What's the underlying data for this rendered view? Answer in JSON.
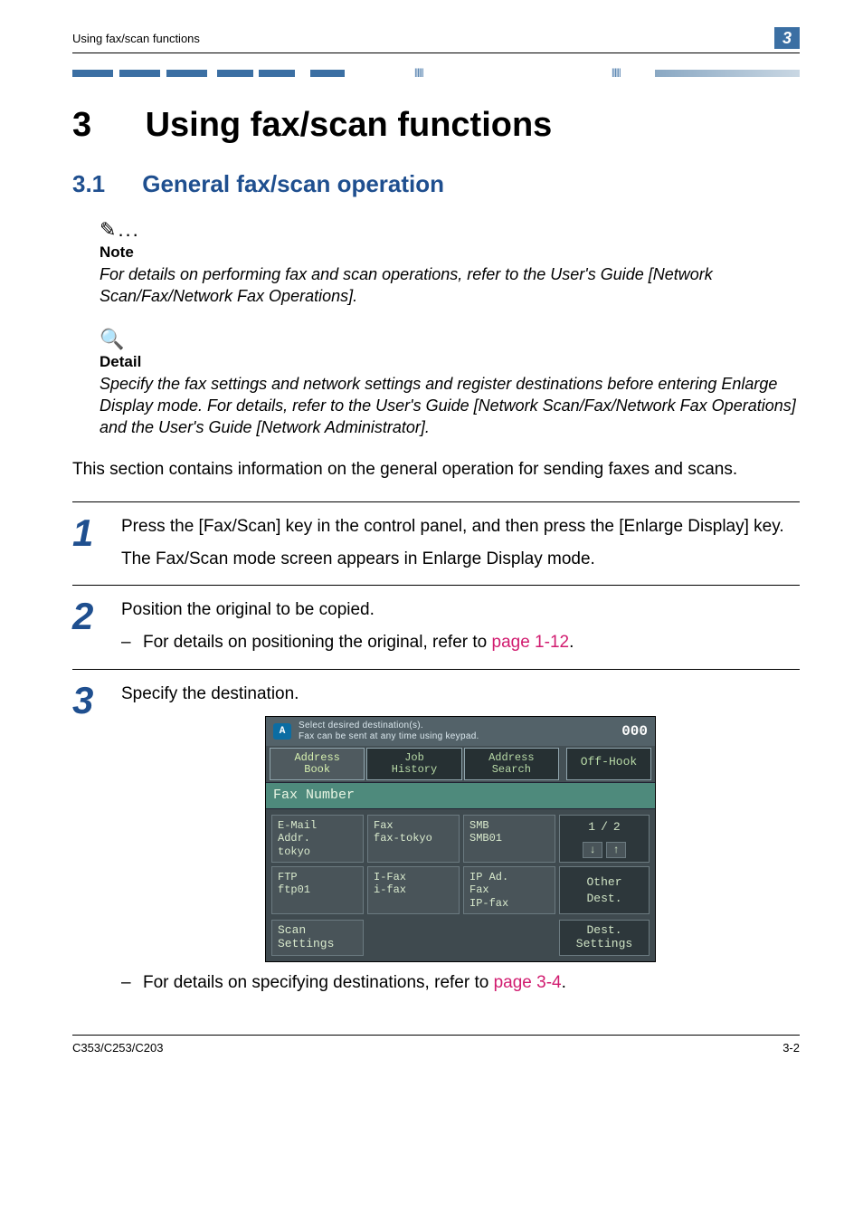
{
  "header": {
    "breadcrumb": "Using fax/scan functions",
    "cornerNum": "3"
  },
  "chapter": {
    "num": "3",
    "title": "Using fax/scan functions"
  },
  "section": {
    "num": "3.1",
    "title": "General fax/scan operation"
  },
  "note": {
    "label": "Note",
    "body": "For details on performing fax and scan operations, refer to the User's Guide [Network Scan/Fax/Network Fax Operations]."
  },
  "detail": {
    "label": "Detail",
    "body": "Specify the fax settings and network settings and register destinations before entering Enlarge Display mode. For details, refer to the User's Guide [Network Scan/Fax/Network Fax Operations] and the User's Guide [Network Administrator]."
  },
  "intro": "This section contains information on the general operation for sending faxes and scans.",
  "steps": {
    "s1": {
      "num": "1",
      "p1": "Press the [Fax/Scan] key in the control panel, and then press the [Enlarge Display] key.",
      "p2": "The Fax/Scan mode screen appears in Enlarge Display mode."
    },
    "s2": {
      "num": "2",
      "p1": "Position the original to be copied.",
      "li1_a": "For details on positioning the original, refer to ",
      "li1_link": "page 1-12",
      "li1_b": "."
    },
    "s3": {
      "num": "3",
      "p1": "Specify the destination.",
      "li1_a": "For details on specifying destinations, refer to ",
      "li1_link": "page 3-4",
      "li1_b": "."
    }
  },
  "ui": {
    "top": {
      "badge": "A",
      "msg1": "Select desired destination(s).",
      "msg2": "Fax can be sent at any time using keypad.",
      "count": "000"
    },
    "tabs": {
      "address_book": "Address\nBook",
      "job_history": "Job\nHistory",
      "address_search": "Address\nSearch",
      "off_hook": "Off-Hook"
    },
    "faxnum_label": "Fax Number",
    "cells": {
      "c11a": "E-Mail\nAddr.",
      "c11b": "tokyo",
      "c12a": "Fax",
      "c12b": "fax-tokyo",
      "c13a": "SMB",
      "c13b": "SMB01",
      "c21a": "FTP",
      "c21b": "ftp01",
      "c22a": "I-Fax",
      "c22b": "i-fax",
      "c23a": "IP Ad.\nFax",
      "c23b": "IP-fax"
    },
    "pager": {
      "page": "1",
      "sep": "/",
      "total": "2",
      "down": "↓",
      "up": "↑"
    },
    "other_dest": "Other\nDest.",
    "scan_settings": "Scan\nSettings",
    "dest_settings": "Dest.\nSettings"
  },
  "footer": {
    "model": "C353/C253/C203",
    "pagenum": "3-2"
  }
}
